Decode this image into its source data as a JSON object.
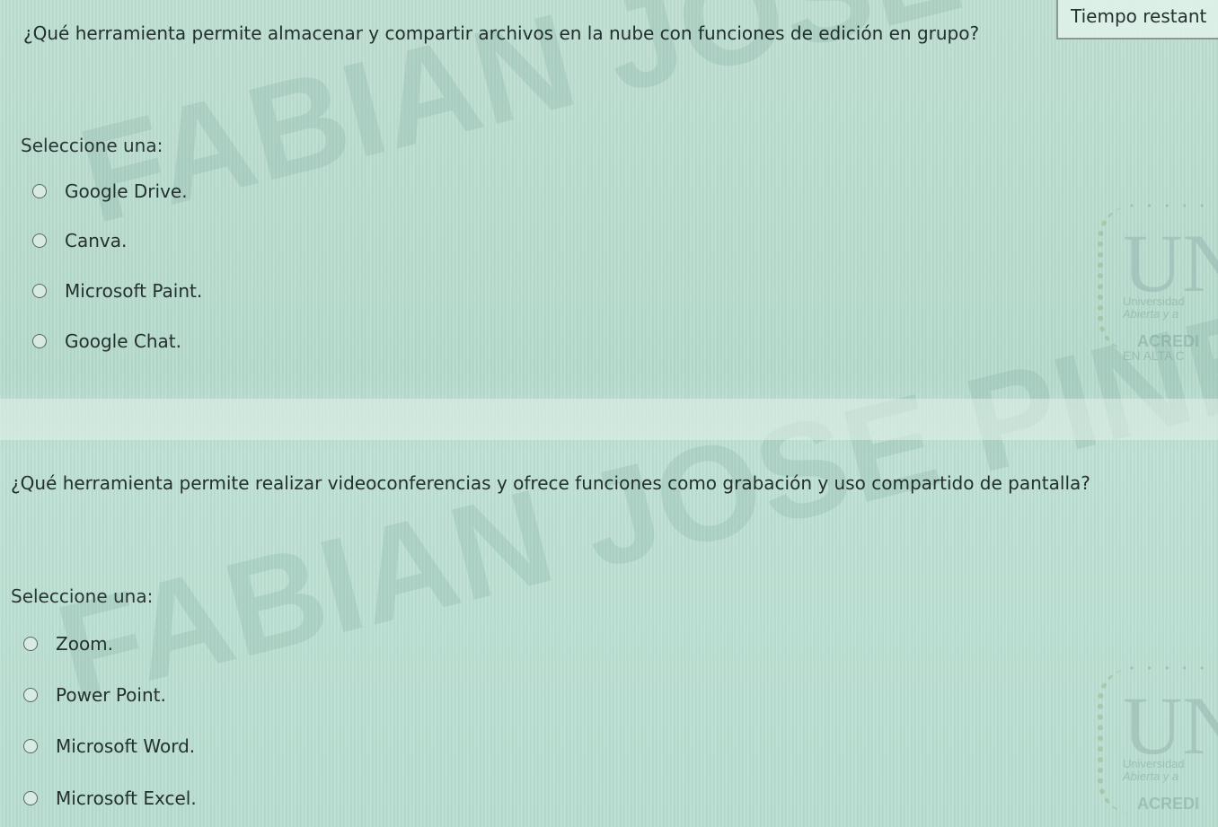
{
  "timer": {
    "label": "Tiempo restant"
  },
  "questions": [
    {
      "text": "¿Qué herramienta permite almacenar y compartir archivos en la nube con funciones de edición en grupo?",
      "prompt": "Seleccione una:",
      "options": [
        "Google Drive.",
        "Canva.",
        "Microsoft Paint.",
        "Google Chat."
      ]
    },
    {
      "text": "¿Qué herramienta permite realizar videoconferencias y ofrece funciones como grabación y uso compartido de pantalla?",
      "prompt": "Seleccione una:",
      "options": [
        "Zoom.",
        "Power Point.",
        "Microsoft Word.",
        "Microsoft Excel."
      ]
    }
  ],
  "watermark": {
    "text": "FABIAN JOSE PINEDA GIL"
  },
  "logo": {
    "dots": "• • • • •",
    "letter": "UN",
    "line1": "Universidad",
    "line2": "Abierta y a",
    "line3": "ACREDI",
    "line4": "EN ALTA C"
  },
  "colors": {
    "background": "#bfe0d3",
    "text": "#22302e",
    "radio_border": "#5a6866"
  }
}
